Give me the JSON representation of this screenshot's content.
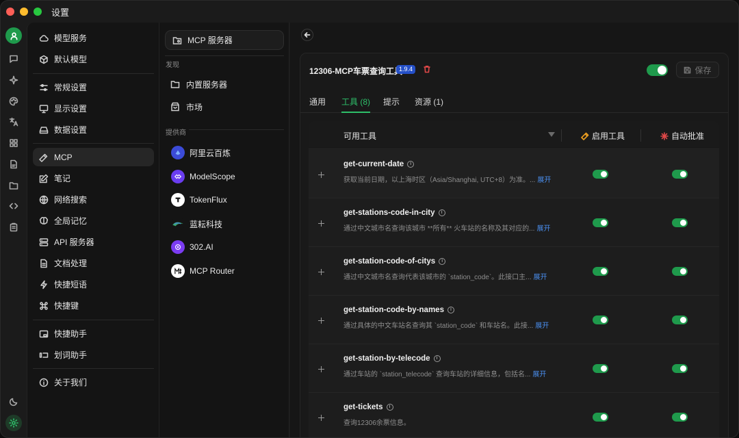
{
  "window": {
    "title": "设置"
  },
  "rail": {
    "icons": [
      "avatar-icon",
      "chat-icon",
      "sparkle-icon",
      "palette-icon",
      "translate-icon",
      "apps-icon",
      "file-icon",
      "folder-icon",
      "code-icon",
      "clipboard-icon",
      "moon-icon",
      "settings-icon"
    ]
  },
  "nav": {
    "items": [
      {
        "label": "模型服务",
        "icon": "cloud-icon"
      },
      {
        "label": "默认模型",
        "icon": "cube-icon"
      },
      {
        "label": "常规设置",
        "icon": "sliders-icon"
      },
      {
        "label": "显示设置",
        "icon": "monitor-icon"
      },
      {
        "label": "数据设置",
        "icon": "hard-drive-icon"
      },
      {
        "label": "MCP",
        "icon": "hammer-icon",
        "active": true
      },
      {
        "label": "笔记",
        "icon": "note-icon"
      },
      {
        "label": "网络搜索",
        "icon": "globe-icon"
      },
      {
        "label": "全局记忆",
        "icon": "brain-icon"
      },
      {
        "label": "API 服务器",
        "icon": "server-icon"
      },
      {
        "label": "文档处理",
        "icon": "document-icon"
      },
      {
        "label": "快捷短语",
        "icon": "bolt-icon"
      },
      {
        "label": "快捷键",
        "icon": "command-icon"
      },
      {
        "label": "快捷助手",
        "icon": "window-icon"
      },
      {
        "label": "划词助手",
        "icon": "text-select-icon"
      },
      {
        "label": "关于我们",
        "icon": "info-icon"
      }
    ]
  },
  "mcp": {
    "top_label": "MCP 服务器",
    "discover_label": "发现",
    "builtin_label": "内置服务器",
    "market_label": "市场",
    "providers_label": "提供商",
    "providers": [
      {
        "name": "阿里云百炼",
        "color": "#5b5bf0"
      },
      {
        "name": "ModelScope",
        "color": "#6a3df0"
      },
      {
        "name": "TokenFlux",
        "color": "#ffffff"
      },
      {
        "name": "蓝耘科技",
        "color": "#2a2a2a"
      },
      {
        "name": "302.AI",
        "color": "#7b3cf2"
      },
      {
        "name": "MCP Router",
        "color": "#ffffff"
      }
    ]
  },
  "server": {
    "name": "12306-MCP车票查询工具",
    "version": "1.9.4",
    "enabled": true,
    "save_label": "保存"
  },
  "tabs": [
    {
      "label": "通用",
      "active": false
    },
    {
      "label": "工具 (8)",
      "active": true
    },
    {
      "label": "提示",
      "active": false
    },
    {
      "label": "资源 (1)",
      "active": false
    }
  ],
  "table": {
    "col_tool": "可用工具",
    "col_enable": "启用工具",
    "col_auto": "自动批准",
    "expand_label": "展开",
    "rows": [
      {
        "name": "get-current-date",
        "desc": "获取当前日期，以上海时区（Asia/Shanghai, UTC+8）为准。...",
        "expandable": true,
        "enabled": true,
        "auto": true
      },
      {
        "name": "get-stations-code-in-city",
        "desc": "通过中文城市名查询该城市 **所有** 火车站的名称及其对应的...",
        "expandable": true,
        "enabled": true,
        "auto": true
      },
      {
        "name": "get-station-code-of-citys",
        "desc": "通过中文城市名查询代表该城市的 `station_code`。此接口主...",
        "expandable": true,
        "enabled": true,
        "auto": true
      },
      {
        "name": "get-station-code-by-names",
        "desc": "通过具体的中文车站名查询其 `station_code` 和车站名。此接...",
        "expandable": true,
        "enabled": true,
        "auto": true
      },
      {
        "name": "get-station-by-telecode",
        "desc": "通过车站的 `station_telecode` 查询车站的详细信息，包括名...",
        "expandable": true,
        "enabled": true,
        "auto": true
      },
      {
        "name": "get-tickets",
        "desc": "查询12306余票信息。",
        "expandable": false,
        "enabled": true,
        "auto": true
      }
    ]
  }
}
